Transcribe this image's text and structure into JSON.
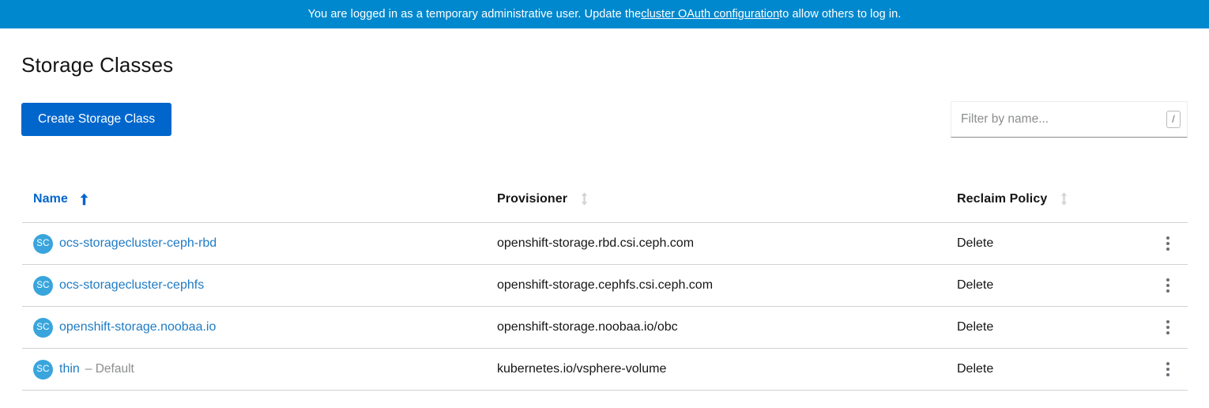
{
  "banner": {
    "text_before": "You are logged in as a temporary administrative user. Update the ",
    "link_label": "cluster OAuth configuration",
    "text_after": " to allow others to log in.",
    "background_color": "#0088ce",
    "text_color": "#ffffff"
  },
  "page": {
    "title": "Storage Classes"
  },
  "toolbar": {
    "create_label": "Create Storage Class",
    "create_color": "#0066cc",
    "filter": {
      "placeholder": "Filter by name...",
      "value": "",
      "shortcut_key": "/"
    }
  },
  "table": {
    "columns": [
      {
        "key": "name",
        "label": "Name",
        "sortable": true,
        "sort_state": "asc",
        "sort_icon": "long-arrow-up-icon"
      },
      {
        "key": "prov",
        "label": "Provisioner",
        "sortable": true,
        "sort_state": "none",
        "sort_icon": "sort-icon"
      },
      {
        "key": "policy",
        "label": "Reclaim Policy",
        "sortable": true,
        "sort_state": "none",
        "sort_icon": "sort-icon"
      }
    ],
    "row_badge_label": "SC",
    "kebab_label": "kebab-menu-icon",
    "rows": [
      {
        "badge": "SC",
        "name": "ocs-storagecluster-ceph-rbd",
        "default_tag": "",
        "provisioner": "openshift-storage.rbd.csi.ceph.com",
        "reclaim_policy": "Delete"
      },
      {
        "badge": "SC",
        "name": "ocs-storagecluster-cephfs",
        "default_tag": "",
        "provisioner": "openshift-storage.cephfs.csi.ceph.com",
        "reclaim_policy": "Delete"
      },
      {
        "badge": "SC",
        "name": "openshift-storage.noobaa.io",
        "default_tag": "",
        "provisioner": "openshift-storage.noobaa.io/obc",
        "reclaim_policy": "Delete"
      },
      {
        "badge": "SC",
        "name": "thin",
        "default_tag": "– Default",
        "provisioner": "kubernetes.io/vsphere-volume",
        "reclaim_policy": "Delete"
      }
    ]
  },
  "colors": {
    "banner_blue": "#0088ce",
    "primary_blue": "#0066cc",
    "link_blue": "#1f7bc4",
    "badge_blue": "#39a5dc",
    "border_gray": "#d2d2d2",
    "muted_gray": "#8b8d8f"
  }
}
